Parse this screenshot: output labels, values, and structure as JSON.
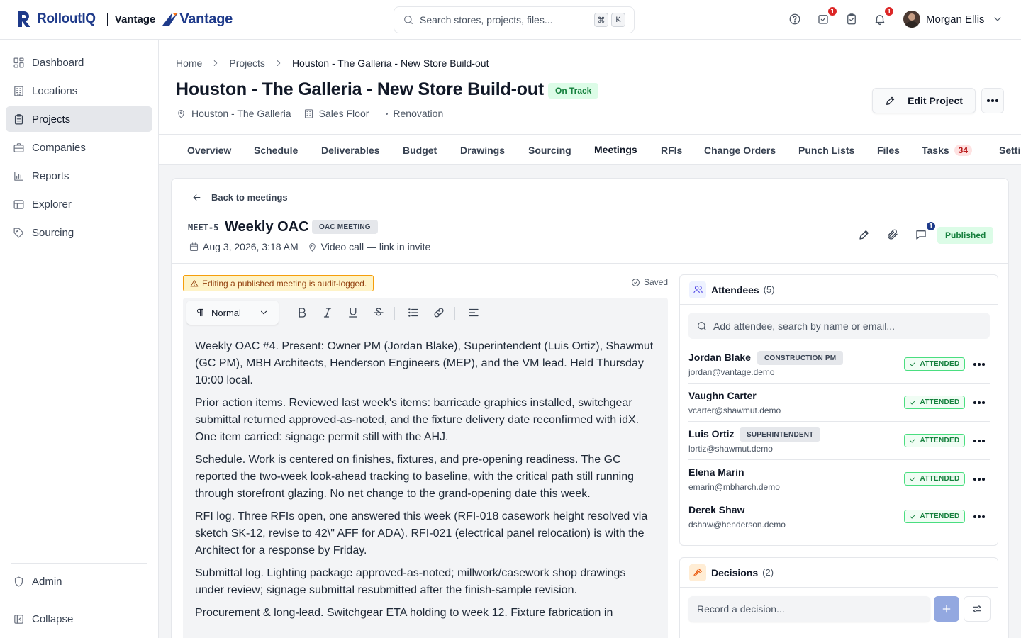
{
  "topbar": {
    "brand": "RolloutIQ",
    "tenant": "Vantage",
    "tenant_logo_text": "Vantage",
    "search_placeholder": "Search stores, projects, files...",
    "shortcut": [
      "⌘",
      "K"
    ],
    "tasks_badge": "1",
    "notifications_badge": "1",
    "user_name": "Morgan Ellis"
  },
  "sidebar": {
    "items": [
      {
        "label": "Dashboard",
        "icon": "dashboard-icon"
      },
      {
        "label": "Locations",
        "icon": "building-icon"
      },
      {
        "label": "Projects",
        "icon": "clipboard-icon"
      },
      {
        "label": "Companies",
        "icon": "briefcase-icon"
      },
      {
        "label": "Reports",
        "icon": "bar-chart-icon"
      },
      {
        "label": "Explorer",
        "icon": "table-icon"
      },
      {
        "label": "Sourcing",
        "icon": "tag-icon"
      }
    ],
    "active": "Projects",
    "admin_label": "Admin",
    "collapse_label": "Collapse"
  },
  "breadcrumb": [
    "Home",
    "Projects",
    "Houston - The Galleria - New Store Build-out"
  ],
  "project": {
    "title": "Houston - The Galleria - New Store Build-out",
    "status": "On Track",
    "location": "Houston - The Galleria",
    "area": "Sales Floor",
    "type": "Renovation",
    "edit_label": "Edit Project"
  },
  "tabs": [
    {
      "label": "Overview"
    },
    {
      "label": "Schedule"
    },
    {
      "label": "Deliverables"
    },
    {
      "label": "Budget"
    },
    {
      "label": "Drawings"
    },
    {
      "label": "Sourcing"
    },
    {
      "label": "Meetings"
    },
    {
      "label": "RFIs"
    },
    {
      "label": "Change Orders"
    },
    {
      "label": "Punch Lists"
    },
    {
      "label": "Files"
    },
    {
      "label": "Tasks",
      "count": "34"
    },
    {
      "label": "Setti"
    }
  ],
  "active_tab": "Meetings",
  "meeting": {
    "back_label": "Back to meetings",
    "code": "MEET-5",
    "title": "Weekly OAC",
    "type": "OAC MEETING",
    "datetime": "Aug 3, 2026, 3:18 AM",
    "location": "Video call — link in invite",
    "comments_count": "1",
    "status": "Published"
  },
  "editor": {
    "warning": "Editing a published meeting is audit-logged.",
    "saved_label": "Saved",
    "paragraph_style": "Normal",
    "paragraphs": [
      "Weekly OAC #4. Present: Owner PM (Jordan Blake), Superintendent (Luis Ortiz), Shawmut (GC PM), MBH Architects, Henderson Engineers (MEP), and the VM lead. Held Thursday 10:00 local.",
      "Prior action items. Reviewed last week's items: barricade graphics installed, switchgear submittal returned approved-as-noted, and the fixture delivery date reconfirmed with idX. One item carried: signage permit still with the AHJ.",
      "Schedule. Work is centered on finishes, fixtures, and pre-opening readiness. The GC reported the two-week look-ahead tracking to baseline, with the critical path still running through storefront glazing. No net change to the grand-opening date this week.",
      "RFI log. Three RFIs open, one answered this week (RFI-018 casework height resolved via sketch SK-12, revise to 42\\\" AFF for ADA). RFI-021 (electrical panel relocation) is with the Architect for a response by Friday.",
      "Submittal log. Lighting package approved-as-noted; millwork/casework shop drawings under review; signage submittal resubmitted after the finish-sample revision.",
      "Procurement & long-lead. Switchgear ETA holding to week 12. Fixture fabrication in"
    ]
  },
  "attendees": {
    "title": "Attendees",
    "count": "(5)",
    "search_placeholder": "Add attendee, search by name or email...",
    "list": [
      {
        "name": "Jordan Blake",
        "role": "CONSTRUCTION PM",
        "email": "jordan@vantage.demo",
        "status": "ATTENDED"
      },
      {
        "name": "Vaughn Carter",
        "role": "",
        "email": "vcarter@shawmut.demo",
        "status": "ATTENDED"
      },
      {
        "name": "Luis Ortiz",
        "role": "SUPERINTENDENT",
        "email": "lortiz@shawmut.demo",
        "status": "ATTENDED"
      },
      {
        "name": "Elena Marin",
        "role": "",
        "email": "emarin@mbharch.demo",
        "status": "ATTENDED"
      },
      {
        "name": "Derek Shaw",
        "role": "",
        "email": "dshaw@henderson.demo",
        "status": "ATTENDED"
      }
    ]
  },
  "decisions": {
    "title": "Decisions",
    "count": "(2)",
    "placeholder": "Record a decision..."
  },
  "colors": {
    "brand": "#1e3a8a",
    "accent": "#1e40af",
    "success": "#15803d",
    "danger": "#dc2626",
    "warning": "#92400e"
  }
}
